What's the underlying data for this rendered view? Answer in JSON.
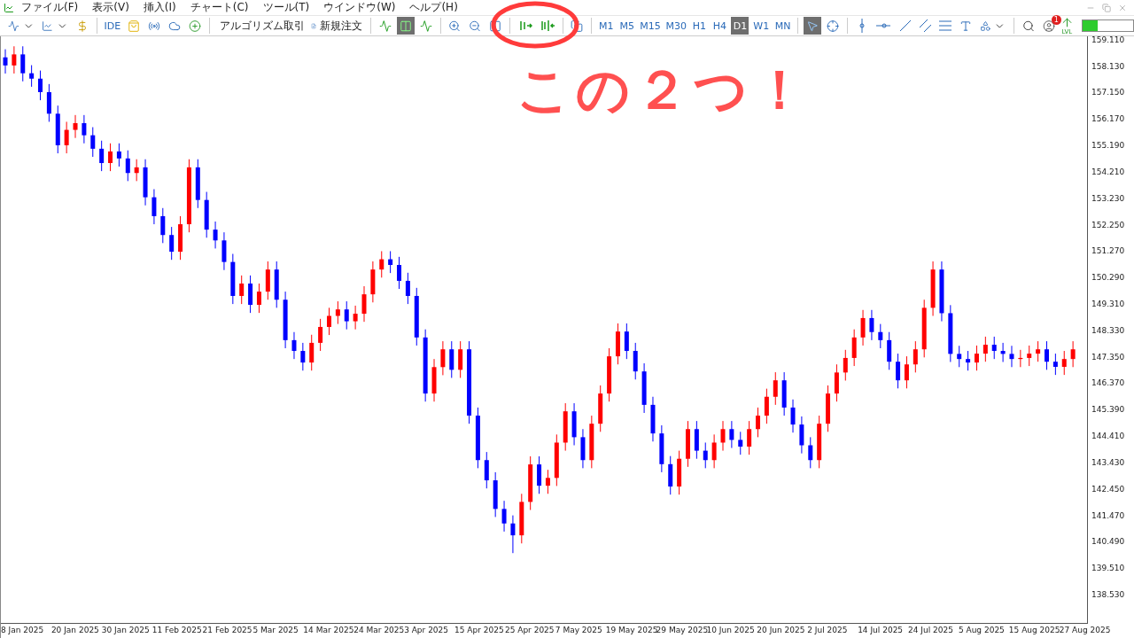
{
  "menu": [
    "ファイル(F)",
    "表示(V)",
    "挿入(I)",
    "チャート(C)",
    "ツール(T)",
    "ウインドウ(W)",
    "ヘルプ(H)"
  ],
  "toolbar": {
    "ide": "IDE",
    "algo_trading": "アルゴリズム取引",
    "new_order": "新規注文",
    "notification_count": "1",
    "level_label": "LVL",
    "level": 0.3
  },
  "timeframes": [
    {
      "label": "M1",
      "selected": false
    },
    {
      "label": "M5",
      "selected": false
    },
    {
      "label": "M15",
      "selected": false
    },
    {
      "label": "M30",
      "selected": false
    },
    {
      "label": "H1",
      "selected": false
    },
    {
      "label": "H4",
      "selected": false
    },
    {
      "label": "D1",
      "selected": true
    },
    {
      "label": "W1",
      "selected": false
    },
    {
      "label": "MN",
      "selected": false
    }
  ],
  "annotation": {
    "text": "この２つ！"
  },
  "chart": {
    "date_labels": [
      "8 Jan 2025",
      "20 Jan 2025",
      "30 Jan 2025",
      "11 Feb 2025",
      "21 Feb 2025",
      "5 Mar 2025",
      "14 Mar 2025",
      "24 Mar 2025",
      "3 Apr 2025",
      "15 Apr 2025",
      "25 Apr 2025",
      "7 May 2025",
      "19 May 2025",
      "29 May 2025",
      "10 Jun 2025",
      "20 Jun 2025",
      "2 Jul 2025",
      "14 Jul 2025",
      "24 Jul 2025",
      "5 Aug 2025",
      "15 Aug 2025",
      "27 Aug 2025"
    ],
    "chart_data": {
      "type": "candlestick",
      "ylim": [
        137.51,
        159.27
      ],
      "ohlc": [
        [
          158.49,
          158.79,
          157.89,
          158.19
        ],
        [
          158.19,
          158.9,
          157.89,
          158.6
        ],
        [
          158.6,
          158.9,
          157.6,
          157.9
        ],
        [
          157.9,
          158.2,
          157.4,
          157.7
        ],
        [
          157.7,
          158.0,
          156.9,
          157.2
        ],
        [
          157.2,
          157.5,
          156.1,
          156.4
        ],
        [
          156.4,
          156.7,
          154.93,
          155.23
        ],
        [
          155.23,
          156.1,
          154.93,
          155.8
        ],
        [
          155.8,
          156.35,
          155.5,
          156.05
        ],
        [
          156.05,
          156.35,
          155.3,
          155.6
        ],
        [
          155.6,
          155.9,
          154.8,
          155.1
        ],
        [
          155.1,
          155.4,
          154.27,
          154.57
        ],
        [
          154.57,
          155.3,
          154.27,
          155.0
        ],
        [
          155.0,
          155.3,
          154.44,
          154.74
        ],
        [
          154.74,
          155.04,
          153.9,
          154.2
        ],
        [
          154.2,
          154.71,
          153.9,
          154.41
        ],
        [
          154.41,
          154.71,
          153.0,
          153.3
        ],
        [
          153.3,
          153.6,
          152.3,
          152.6
        ],
        [
          152.6,
          152.9,
          151.6,
          151.9
        ],
        [
          151.9,
          152.2,
          150.98,
          151.28
        ],
        [
          151.28,
          152.6,
          150.98,
          152.3
        ],
        [
          152.3,
          154.71,
          152.0,
          154.41
        ],
        [
          154.41,
          154.71,
          152.9,
          153.2
        ],
        [
          153.2,
          153.5,
          151.8,
          152.1
        ],
        [
          152.1,
          152.4,
          151.4,
          151.7
        ],
        [
          151.7,
          152.0,
          150.6,
          150.9
        ],
        [
          150.9,
          151.2,
          149.34,
          149.64
        ],
        [
          149.64,
          150.4,
          149.34,
          150.1
        ],
        [
          150.1,
          150.4,
          149.01,
          149.31
        ],
        [
          149.31,
          150.1,
          149.01,
          149.8
        ],
        [
          149.8,
          150.92,
          149.5,
          150.62
        ],
        [
          150.62,
          150.92,
          149.2,
          149.5
        ],
        [
          149.5,
          149.8,
          147.7,
          148.0
        ],
        [
          148.0,
          148.3,
          147.3,
          147.6
        ],
        [
          147.6,
          147.9,
          146.87,
          147.17
        ],
        [
          147.17,
          148.2,
          146.87,
          147.9
        ],
        [
          147.9,
          148.79,
          147.6,
          148.49
        ],
        [
          148.49,
          149.2,
          148.19,
          148.9
        ],
        [
          148.9,
          149.44,
          148.6,
          149.14
        ],
        [
          149.14,
          149.44,
          148.4,
          148.7
        ],
        [
          148.7,
          149.28,
          148.4,
          148.98
        ],
        [
          148.98,
          150.0,
          148.68,
          149.7
        ],
        [
          149.7,
          150.92,
          149.4,
          150.62
        ],
        [
          150.62,
          151.3,
          150.32,
          151.0
        ],
        [
          151.0,
          151.3,
          150.49,
          150.79
        ],
        [
          150.79,
          151.09,
          149.9,
          150.2
        ],
        [
          150.2,
          150.5,
          149.34,
          149.64
        ],
        [
          149.64,
          149.94,
          147.8,
          148.1
        ],
        [
          148.1,
          148.4,
          145.72,
          146.02
        ],
        [
          146.02,
          147.3,
          145.72,
          147.0
        ],
        [
          147.0,
          147.96,
          146.7,
          147.66
        ],
        [
          147.66,
          147.96,
          146.6,
          146.9
        ],
        [
          146.9,
          147.96,
          146.6,
          147.66
        ],
        [
          147.66,
          147.96,
          144.9,
          145.2
        ],
        [
          145.2,
          145.5,
          143.25,
          143.55
        ],
        [
          143.55,
          143.85,
          142.5,
          142.8
        ],
        [
          142.8,
          143.1,
          141.44,
          141.74
        ],
        [
          141.74,
          142.04,
          140.9,
          141.2
        ],
        [
          141.2,
          141.5,
          140.1,
          140.76
        ],
        [
          140.76,
          142.3,
          140.46,
          142.0
        ],
        [
          142.0,
          143.69,
          141.7,
          143.39
        ],
        [
          143.39,
          143.69,
          142.3,
          142.6
        ],
        [
          142.6,
          143.19,
          142.3,
          142.89
        ],
        [
          142.89,
          144.5,
          142.59,
          144.2
        ],
        [
          144.2,
          145.66,
          143.9,
          145.36
        ],
        [
          145.36,
          145.66,
          144.1,
          144.4
        ],
        [
          144.4,
          144.7,
          143.25,
          143.55
        ],
        [
          143.55,
          145.2,
          143.25,
          144.9
        ],
        [
          144.9,
          146.32,
          144.6,
          146.02
        ],
        [
          146.02,
          147.7,
          145.72,
          147.4
        ],
        [
          147.4,
          148.62,
          147.1,
          148.32
        ],
        [
          148.32,
          148.62,
          147.3,
          147.6
        ],
        [
          147.6,
          147.9,
          146.54,
          146.84
        ],
        [
          146.84,
          147.14,
          145.3,
          145.6
        ],
        [
          145.6,
          145.9,
          144.24,
          144.54
        ],
        [
          144.54,
          144.84,
          143.1,
          143.4
        ],
        [
          143.4,
          143.7,
          142.27,
          142.57
        ],
        [
          142.57,
          143.9,
          142.27,
          143.6
        ],
        [
          143.6,
          145.0,
          143.3,
          144.7
        ],
        [
          144.7,
          145.0,
          143.6,
          143.9
        ],
        [
          143.9,
          144.2,
          143.25,
          143.55
        ],
        [
          143.55,
          144.5,
          143.25,
          144.2
        ],
        [
          144.2,
          145.0,
          143.9,
          144.7
        ],
        [
          144.7,
          145.0,
          144.0,
          144.3
        ],
        [
          144.3,
          144.6,
          143.75,
          144.05
        ],
        [
          144.05,
          145.0,
          143.75,
          144.7
        ],
        [
          144.7,
          145.5,
          144.4,
          145.2
        ],
        [
          145.2,
          146.2,
          144.9,
          145.9
        ],
        [
          145.9,
          146.81,
          145.6,
          146.51
        ],
        [
          146.51,
          146.81,
          145.2,
          145.5
        ],
        [
          145.5,
          145.8,
          144.57,
          144.87
        ],
        [
          144.87,
          145.17,
          143.8,
          144.1
        ],
        [
          144.1,
          144.4,
          143.25,
          143.55
        ],
        [
          143.55,
          145.2,
          143.25,
          144.9
        ],
        [
          144.9,
          146.32,
          144.6,
          146.02
        ],
        [
          146.02,
          147.1,
          145.72,
          146.8
        ],
        [
          146.8,
          147.64,
          146.5,
          147.34
        ],
        [
          147.34,
          148.4,
          147.04,
          148.1
        ],
        [
          148.1,
          149.12,
          147.8,
          148.82
        ],
        [
          148.82,
          149.12,
          148.0,
          148.3
        ],
        [
          148.3,
          148.6,
          147.7,
          148.0
        ],
        [
          148.0,
          148.3,
          146.9,
          147.2
        ],
        [
          147.2,
          147.5,
          146.21,
          146.51
        ],
        [
          146.51,
          147.4,
          146.21,
          147.1
        ],
        [
          147.1,
          147.96,
          146.8,
          147.66
        ],
        [
          147.66,
          149.5,
          147.36,
          149.2
        ],
        [
          149.2,
          150.92,
          148.9,
          150.62
        ],
        [
          150.62,
          150.92,
          148.7,
          149.0
        ],
        [
          149.0,
          149.3,
          147.19,
          147.49
        ],
        [
          147.49,
          147.79,
          147.0,
          147.3
        ],
        [
          147.3,
          147.6,
          146.87,
          147.17
        ],
        [
          147.17,
          147.8,
          146.87,
          147.5
        ],
        [
          147.5,
          148.13,
          147.2,
          147.83
        ],
        [
          147.83,
          148.13,
          147.3,
          147.6
        ],
        [
          147.6,
          147.9,
          147.19,
          147.49
        ],
        [
          147.49,
          147.79,
          147.0,
          147.3
        ],
        [
          147.3,
          147.64,
          147.0,
          147.34
        ],
        [
          147.34,
          147.8,
          147.04,
          147.5
        ],
        [
          147.5,
          147.96,
          147.2,
          147.66
        ],
        [
          147.66,
          147.96,
          146.9,
          147.2
        ],
        [
          147.2,
          147.5,
          146.71,
          147.01
        ],
        [
          147.01,
          147.6,
          146.71,
          147.3
        ],
        [
          147.3,
          147.96,
          147.0,
          147.66
        ]
      ],
      "yticks": [
        {
          "value": 159.11,
          "label": "159.110"
        },
        {
          "value": 158.13,
          "label": "158.130"
        },
        {
          "value": 157.15,
          "label": "157.150"
        },
        {
          "value": 156.17,
          "label": "156.170"
        },
        {
          "value": 155.19,
          "label": "155.190"
        },
        {
          "value": 154.21,
          "label": "154.210"
        },
        {
          "value": 153.23,
          "label": "153.230"
        },
        {
          "value": 152.25,
          "label": "152.250"
        },
        {
          "value": 151.27,
          "label": "151.270"
        },
        {
          "value": 150.29,
          "label": "150.290"
        },
        {
          "value": 149.31,
          "label": "149.310"
        },
        {
          "value": 148.33,
          "label": "148.330"
        },
        {
          "value": 147.35,
          "label": "147.350"
        },
        {
          "value": 146.37,
          "label": "146.370"
        },
        {
          "value": 145.39,
          "label": "145.390"
        },
        {
          "value": 144.41,
          "label": "144.410"
        },
        {
          "value": 143.43,
          "label": "143.430"
        },
        {
          "value": 142.45,
          "label": "142.450"
        },
        {
          "value": 141.47,
          "label": "141.470"
        },
        {
          "value": 140.49,
          "label": "140.490"
        },
        {
          "value": 139.51,
          "label": "139.510"
        },
        {
          "value": 138.53,
          "label": "138.530"
        }
      ]
    }
  }
}
